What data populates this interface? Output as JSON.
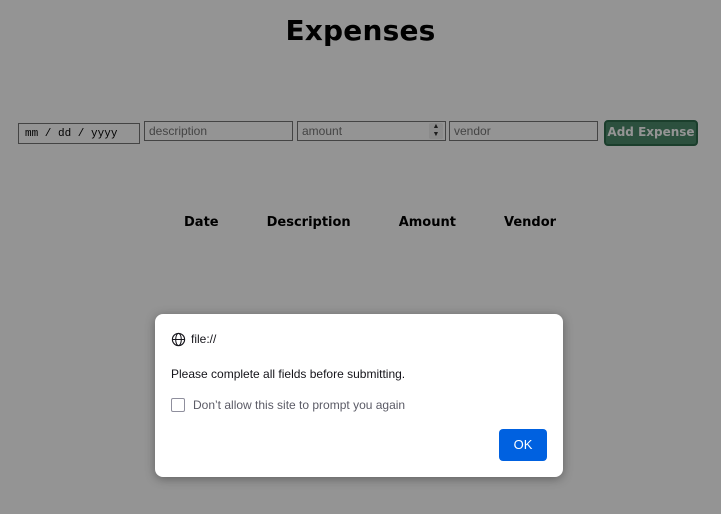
{
  "page": {
    "title": "Expenses"
  },
  "form": {
    "date_placeholder": "mm / dd / yyyy",
    "description_placeholder": "description",
    "amount_placeholder": "amount",
    "vendor_placeholder": "vendor",
    "submit_label": "Add Expense",
    "submit_color": "#4c8a6b"
  },
  "table": {
    "headers": [
      "Date",
      "Description",
      "Amount",
      "Vendor"
    ],
    "rows": []
  },
  "dialog": {
    "origin": "file://",
    "origin_icon": "globe-icon",
    "message": "Please complete all fields before submitting.",
    "checkbox_label": "Don’t allow this site to prompt you again",
    "checkbox_checked": false,
    "ok_label": "OK",
    "ok_color": "#0061e0"
  }
}
